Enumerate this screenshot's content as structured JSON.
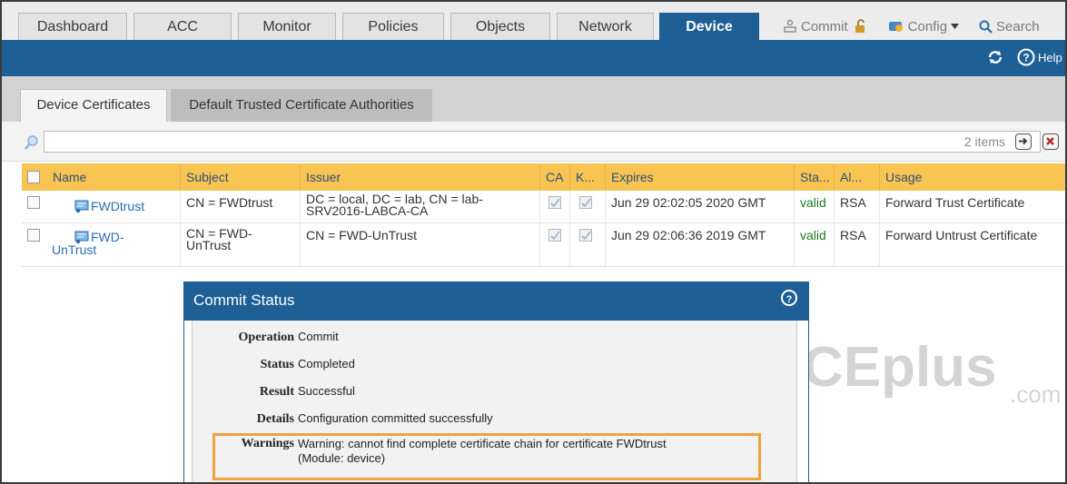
{
  "nav": {
    "tabs": [
      "Dashboard",
      "ACC",
      "Monitor",
      "Policies",
      "Objects",
      "Network",
      "Device"
    ],
    "active_tab": "Device",
    "commit_label": "Commit",
    "config_label": "Config",
    "search_label": "Search"
  },
  "header": {
    "help_label": "Help"
  },
  "subtabs": {
    "active": "Device Certificates",
    "inactive": "Default Trusted Certificate Authorities"
  },
  "filter": {
    "items_count": "2 items"
  },
  "table": {
    "columns": {
      "name": "Name",
      "subject": "Subject",
      "issuer": "Issuer",
      "ca": "CA",
      "key": "K...",
      "expires": "Expires",
      "status": "Sta...",
      "algorithm": "Al...",
      "usage": "Usage"
    },
    "rows": [
      {
        "name": "FWDtrust",
        "subject": "CN = FWDtrust",
        "issuer_line1": "DC = local, DC = lab, CN = lab-",
        "issuer_line2": "SRV2016-LABCA-CA",
        "expires": "Jun 29 02:02:05 2020 GMT",
        "status": "valid",
        "algorithm": "RSA",
        "usage": "Forward Trust Certificate"
      },
      {
        "name_line1": "FWD-",
        "name_line2": "UnTrust",
        "subject_line1": "CN = FWD-",
        "subject_line2": "UnTrust",
        "issuer": "CN = FWD-UnTrust",
        "expires": "Jun 29 02:06:36 2019 GMT",
        "status": "valid",
        "algorithm": "RSA",
        "usage": "Forward Untrust Certificate"
      }
    ]
  },
  "dialog": {
    "title": "Commit Status",
    "fields": {
      "operation_label": "Operation",
      "operation_value": "Commit",
      "status_label": "Status",
      "status_value": "Completed",
      "result_label": "Result",
      "result_value": "Successful",
      "details_label": "Details",
      "details_value": "Configuration committed successfully",
      "warnings_label": "Warnings",
      "warnings_line1": "Warning: cannot find complete certificate chain for certificate FWDtrust",
      "warnings_line2": "(Module: device)"
    }
  },
  "watermark": {
    "brand": "CEplus",
    "suffix": ".com"
  },
  "colors": {
    "primary_blue": "#1e5f96",
    "header_gold": "#f8c553",
    "warning_orange": "#f0a33a",
    "valid_green": "#1f7a1f",
    "link_blue": "#2b6bb0"
  },
  "icons": [
    "commit-icon",
    "lock-icon",
    "config-icon",
    "search-icon",
    "refresh-icon",
    "help-icon",
    "magnifier-icon",
    "add-filter-icon",
    "clear-filter-icon",
    "certificate-icon"
  ]
}
